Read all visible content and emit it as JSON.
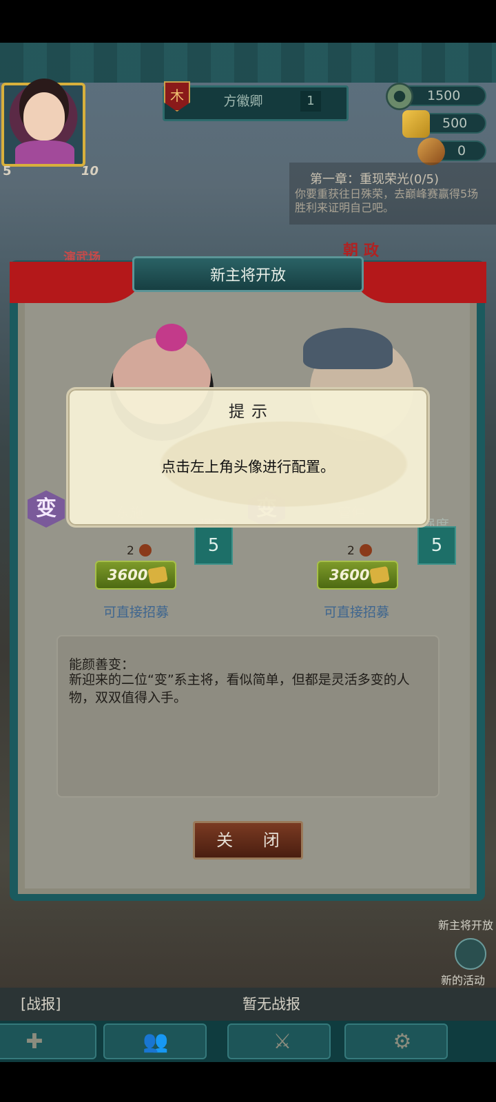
{
  "player": {
    "name": "方徽卿",
    "level": "1",
    "avatar_level_left": "5",
    "avatar_level_right": "10"
  },
  "resources": {
    "coins": "1500",
    "gold": "500",
    "scrolls": "0"
  },
  "chapter": {
    "title": "第一章：重现荣光(0/5)",
    "description": "你要重获往日殊荣，去巅峰赛赢得5场胜利来证明自己吧。"
  },
  "map_labels": {
    "left": "演武场",
    "right": "朝政"
  },
  "modal": {
    "title": "新主将开放",
    "heroes": [
      {
        "name": "东施",
        "badge": "变",
        "strength_label": "强度",
        "strength": "5",
        "cost_count": "2",
        "price": "3600",
        "recruit_label": "可直接招募"
      },
      {
        "name": "管仲",
        "badge": "变",
        "strength_label": "强度",
        "strength": "5",
        "cost_count": "2",
        "price": "3600",
        "recruit_label": "可直接招募"
      }
    ],
    "description_title": "能颜善变：",
    "description_body": "新迎来的二位“变”系主将，看似简单，但都是灵活多变的人物，双双值得入手。",
    "close_label": "关 闭"
  },
  "tip": {
    "title": "提示",
    "message": "点击左上角头像进行配置。"
  },
  "side": {
    "new_hero_label": "新主将开放",
    "new_event_label": "新的活动"
  },
  "battle": {
    "label": "[战报]",
    "status": "暂无战报"
  },
  "nav": {
    "icons": [
      "signpost-icon",
      "people-icon",
      "crossed-swords-icon",
      "gear-icon"
    ]
  }
}
